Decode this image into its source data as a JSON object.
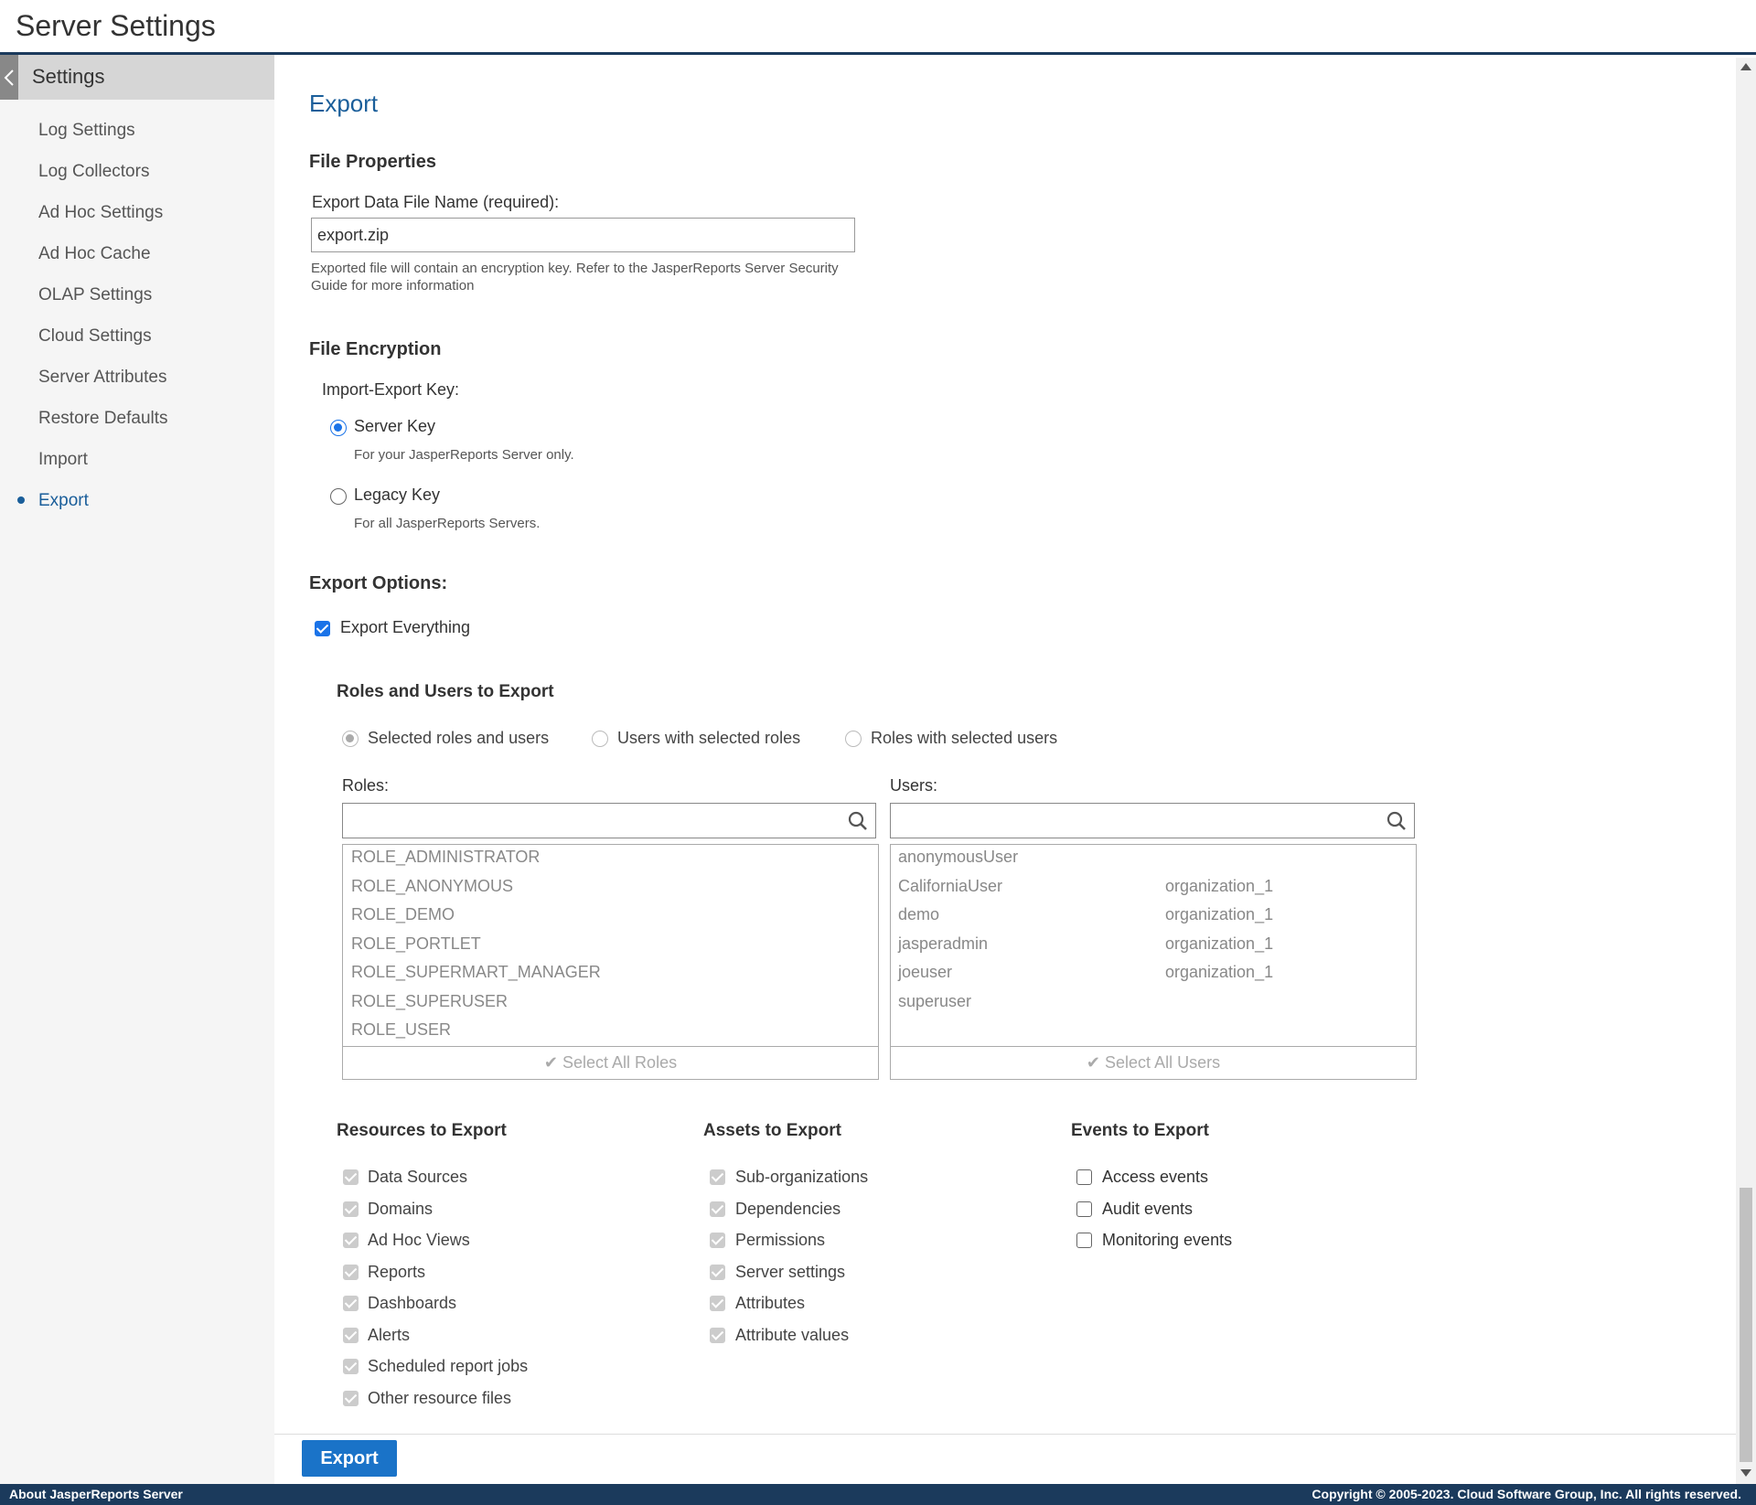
{
  "header": {
    "title": "Server Settings"
  },
  "sidebar": {
    "title": "Settings",
    "items": [
      {
        "label": "Log Settings"
      },
      {
        "label": "Log Collectors"
      },
      {
        "label": "Ad Hoc Settings"
      },
      {
        "label": "Ad Hoc Cache"
      },
      {
        "label": "OLAP Settings"
      },
      {
        "label": "Cloud Settings"
      },
      {
        "label": "Server Attributes"
      },
      {
        "label": "Restore Defaults"
      },
      {
        "label": "Import"
      },
      {
        "label": "Export",
        "active": true
      }
    ]
  },
  "main": {
    "page_title": "Export",
    "file_properties": {
      "heading": "File Properties",
      "filename_label": "Export Data File Name (required):",
      "filename_value": "export.zip",
      "hint_line1": "Exported file will contain an encryption key. Refer to the JasperReports Server Security",
      "hint_line2": "Guide for more information"
    },
    "encryption": {
      "heading": "File Encryption",
      "key_label": "Import-Export Key:",
      "server_key": "Server Key",
      "server_key_hint": "For your JasperReports Server only.",
      "legacy_key": "Legacy Key",
      "legacy_key_hint": "For all JasperReports Servers.",
      "selected": "server"
    },
    "options": {
      "heading": "Export Options:",
      "export_everything": "Export Everything",
      "export_everything_checked": true
    },
    "roles_users": {
      "heading": "Roles and Users to Export",
      "mode_options": [
        "Selected roles and users",
        "Users with selected roles",
        "Roles with selected users"
      ],
      "roles_label": "Roles:",
      "users_label": "Users:",
      "roles": [
        "ROLE_ADMINISTRATOR",
        "ROLE_ANONYMOUS",
        "ROLE_DEMO",
        "ROLE_PORTLET",
        "ROLE_SUPERMART_MANAGER",
        "ROLE_SUPERUSER",
        "ROLE_USER"
      ],
      "users": [
        {
          "name": "anonymousUser",
          "org": ""
        },
        {
          "name": "CaliforniaUser",
          "org": "organization_1"
        },
        {
          "name": "demo",
          "org": "organization_1"
        },
        {
          "name": "jasperadmin",
          "org": "organization_1"
        },
        {
          "name": "joeuser",
          "org": "organization_1"
        },
        {
          "name": "superuser",
          "org": ""
        }
      ],
      "select_all_roles": "Select All Roles",
      "select_all_users": "Select All Users"
    },
    "resources": {
      "heading": "Resources to Export",
      "items": [
        "Data Sources",
        "Domains",
        "Ad Hoc Views",
        "Reports",
        "Dashboards",
        "Alerts",
        "Scheduled report jobs",
        "Other resource files"
      ]
    },
    "assets": {
      "heading": "Assets to Export",
      "items": [
        "Sub-organizations",
        "Dependencies",
        "Permissions",
        "Server settings",
        "Attributes",
        "Attribute values"
      ]
    },
    "events": {
      "heading": "Events to Export",
      "items": [
        "Access events",
        "Audit events",
        "Monitoring events"
      ]
    },
    "export_button": "Export"
  },
  "status_bar": {
    "left": "About JasperReports Server",
    "right": "Copyright © 2005-2023. Cloud Software Group, Inc. All rights reserved."
  },
  "colors": {
    "accent": "#1a5e9a",
    "button": "#1a73c8",
    "status_bar": "#1b3a5c"
  }
}
